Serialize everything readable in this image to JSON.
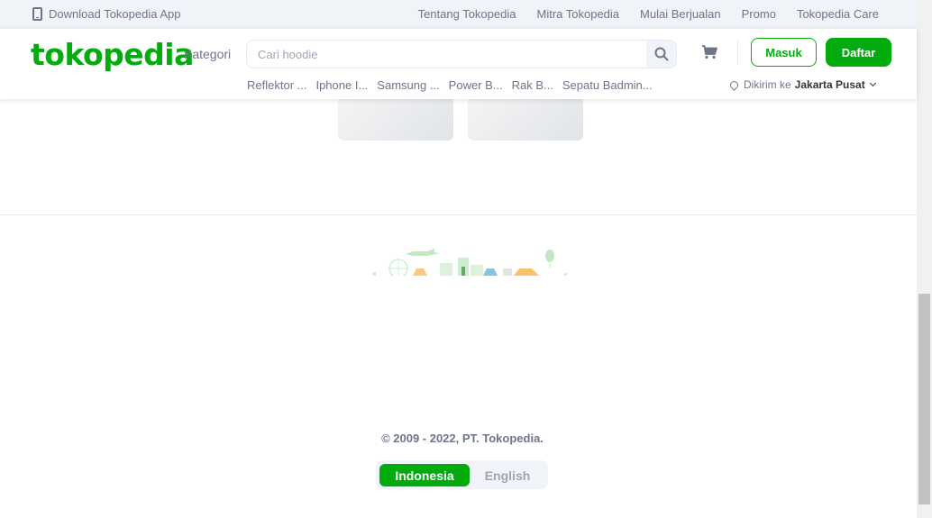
{
  "topbar": {
    "download_label": "Download Tokopedia App",
    "links": [
      "Tentang Tokopedia",
      "Mitra Tokopedia",
      "Mulai Berjualan",
      "Promo",
      "Tokopedia Care"
    ]
  },
  "header": {
    "logo": "tokopedia",
    "kategori": "Kategori",
    "search_placeholder": "Cari hoodie",
    "masuk": "Masuk",
    "daftar": "Daftar",
    "suggestions": [
      "Reflektor ...",
      "Iphone I...",
      "Samsung ...",
      "Power B...",
      "Rak B...",
      "Sepatu Badmin..."
    ],
    "location_prefix": "Dikirim ke",
    "location_city": "Jakarta Pusat"
  },
  "footer": {
    "copyright": "© 2009 - 2022, PT. Tokopedia.",
    "lang_id": "Indonesia",
    "lang_en": "English"
  },
  "colors": {
    "brand": "#03ac0e",
    "text_muted": "#6d7588",
    "bg_gray": "#f0f3f7"
  },
  "icons": [
    "phone-icon",
    "search-icon",
    "cart-icon",
    "location-pin-icon",
    "chevron-down-icon"
  ]
}
